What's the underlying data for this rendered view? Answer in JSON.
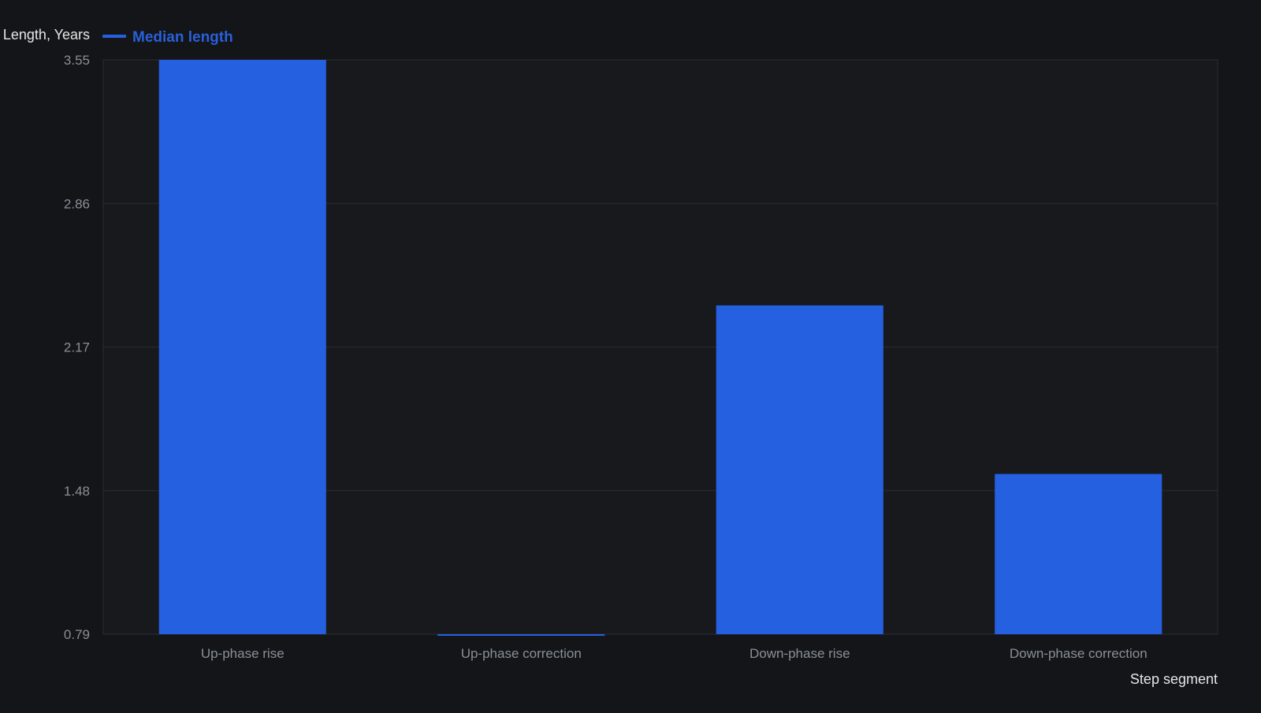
{
  "chart_data": {
    "type": "bar",
    "ylabel": "Length, Years",
    "xlabel": "Step segment",
    "categories": [
      "Up-phase rise",
      "Up-phase correction",
      "Down-phase rise",
      "Down-phase correction"
    ],
    "series": [
      {
        "name": "Median length",
        "values": [
          3.55,
          0.785,
          2.37,
          1.56
        ]
      }
    ],
    "ylim": [
      0.79,
      3.55
    ],
    "yticks": [
      "3.55",
      "2.86",
      "2.17",
      "1.48",
      "0.79"
    ],
    "grid": true,
    "legend_position": "top-left",
    "colors": {
      "bar": "#2560E0",
      "legend_text": "#2A5FDB",
      "background": "#131518",
      "plot_background": "#17191d",
      "grid": "#2a2d33",
      "tick_text": "#8a8f98",
      "axis_title_text": "#e6e6e6"
    }
  }
}
